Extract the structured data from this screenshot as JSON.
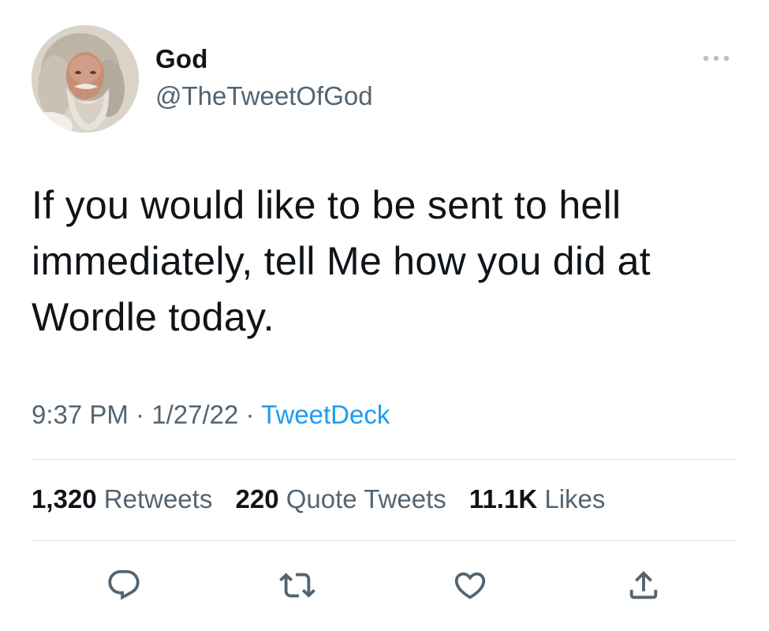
{
  "author": {
    "display_name": "God",
    "handle": "@TheTweetOfGod"
  },
  "tweet": {
    "text": "If you would like to be sent to hell immediately, tell Me how you did at Wordle today.",
    "time": "9:37 PM",
    "date": "1/27/22",
    "separator": "·",
    "source": "TweetDeck"
  },
  "stats": {
    "retweets_count": "1,320",
    "retweets_label": "Retweets",
    "quotes_count": "220",
    "quotes_label": "Quote Tweets",
    "likes_count": "11.1K",
    "likes_label": "Likes"
  },
  "icons": {
    "more": "more-dots-icon",
    "reply": "reply-icon",
    "retweet": "retweet-icon",
    "like": "heart-icon",
    "share": "share-icon"
  },
  "colors": {
    "text": "#0f1419",
    "secondary": "#536471",
    "link": "#1d9bf0",
    "divider": "#dfe3e6"
  }
}
